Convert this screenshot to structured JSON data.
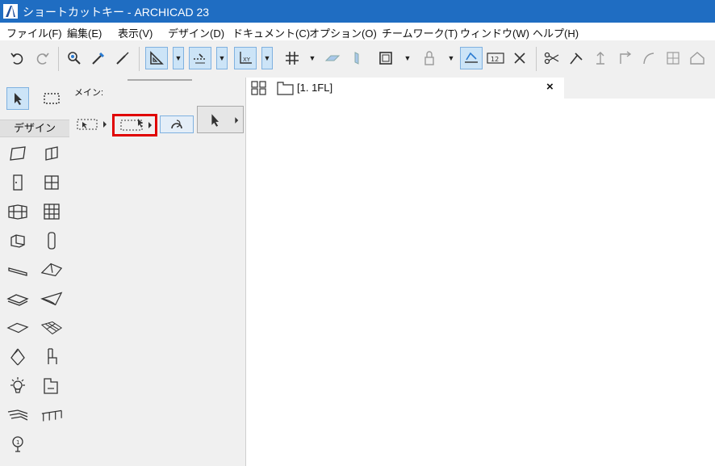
{
  "window": {
    "title": "ショートカットキー - ARCHICAD 23"
  },
  "menubar": {
    "items": [
      "ファイル(F)",
      "編集(E)",
      "表示(V)",
      "デザイン(D)",
      "ドキュメント(C)",
      "オプション(O)",
      "チームワーク(T)",
      "ウィンドウ(W)",
      "ヘルプ(H)"
    ]
  },
  "toolbar": {
    "icons": [
      "undo-icon",
      "redo-icon",
      "magic-wand-icon",
      "eyedropper-icon",
      "syringe-icon",
      "guide-line-icon",
      "snap-guide-icon",
      "coordinate-icon",
      "grid-snap-icon",
      "surface-icon",
      "section-icon",
      "layer-icon",
      "lock-icon",
      "trace-icon",
      "measure-icon",
      "cross-icon",
      "scissors-icon",
      "trim-icon",
      "elevate-icon",
      "offset-icon",
      "curve-icon",
      "split-icon",
      "home-icon"
    ]
  },
  "toolbox": {
    "design_tab": "デザイン",
    "tools": [
      "wall",
      "column",
      "door",
      "window",
      "curtain-wall",
      "skylight",
      "object",
      "column-tall",
      "beam",
      "roof",
      "slab",
      "shell",
      "mesh",
      "morph",
      "stair",
      "chair",
      "lamp",
      "zone",
      "railing",
      "fence",
      "marker"
    ]
  },
  "infobox": {
    "main_label": "メイン:"
  },
  "view_tab": {
    "label": "[1. 1FL]",
    "close": "×"
  },
  "colors": {
    "titlebar": "#1f6dc2",
    "highlight": "#e00000",
    "active_bg": "#cce4f7"
  }
}
